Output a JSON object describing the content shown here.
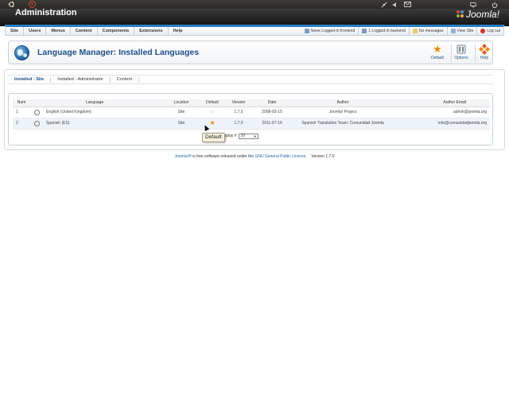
{
  "os_panel": {
    "icons": [
      "ubuntu-logo-icon",
      "close-icon",
      "network-icon",
      "volume-icon",
      "mail-icon",
      "settings-icon",
      "power-icon"
    ]
  },
  "header": {
    "title": "Administration",
    "logo_text": "Joomla!"
  },
  "menu": {
    "items": [
      "Site",
      "Users",
      "Menus",
      "Content",
      "Components",
      "Extensions",
      "Help"
    ],
    "status": {
      "frontend": "None Logged-in frontend",
      "backend": "1 Logged-in backend",
      "messages": "No messages",
      "view_site": "View Site",
      "logout": "Log out"
    }
  },
  "toolbar": {
    "title": "Language Manager: Installed Languages",
    "buttons": {
      "default": "Default",
      "options": "Options",
      "help": "Help"
    }
  },
  "tabs": [
    "Installed - Site",
    "Installed - Administrator",
    "Content"
  ],
  "table": {
    "columns": {
      "num": "Num",
      "language": "Language",
      "location": "Location",
      "default": "Default",
      "version": "Version",
      "date": "Date",
      "author": "Author",
      "author_email": "Author Email"
    },
    "rows": [
      {
        "num": "1",
        "language": "English (United Kingdom)",
        "location": "Site",
        "is_default": false,
        "version": "1.7.0",
        "date": "2008-03-15",
        "author": "Joomla! Project",
        "email": "admin@joomla.org"
      },
      {
        "num": "2",
        "language": "Spanish (ES)",
        "location": "Site",
        "is_default": true,
        "version": "1.7.0",
        "date": "2011-07-19",
        "author": "Spanish Translation Team: Comunidad Joomla",
        "email": "info@comunidadjoomla.org"
      }
    ]
  },
  "pager": {
    "display_label": "Display #",
    "display_value": "20"
  },
  "tooltip": {
    "text": "Default"
  },
  "footer": {
    "link1": "Joomla!®",
    "text1": " is free software released under the ",
    "link2": "GNU General Public License",
    "text2": ".    Version 1.7.0"
  },
  "colors": {
    "accent": "#2b7fc2",
    "title_blue": "#1d4f8c",
    "star_on": "#f08a00"
  }
}
